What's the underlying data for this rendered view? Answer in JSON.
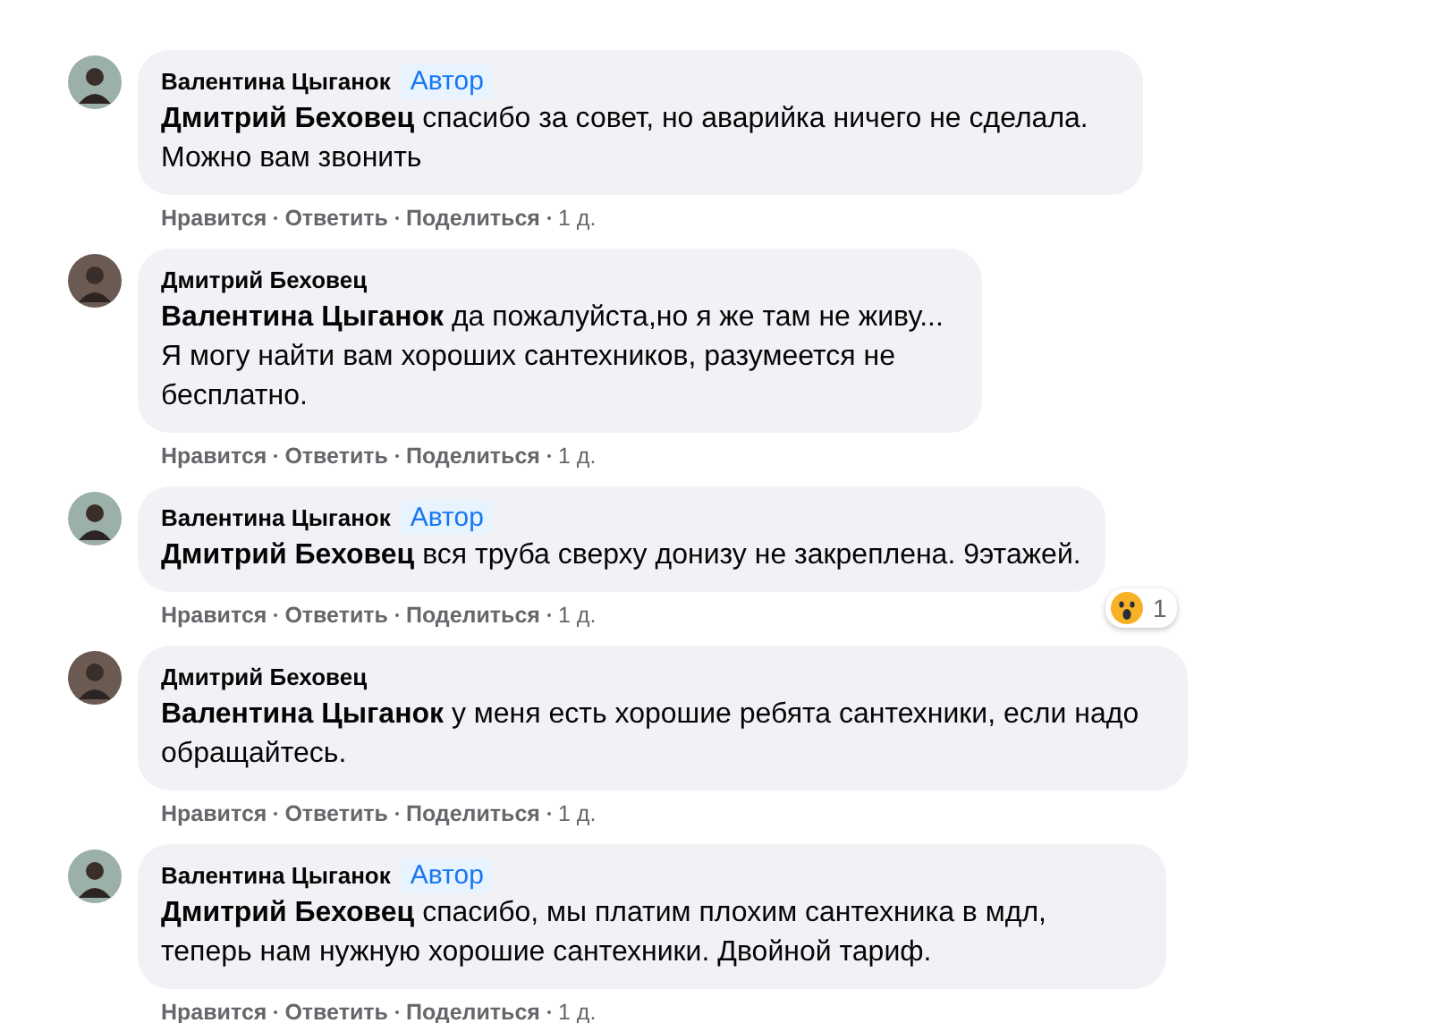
{
  "comments": [
    {
      "author": "Валентина Цыганок",
      "author_badge": "Автор",
      "mention": "Дмитрий Беховец",
      "text": "спасибо за совет, но аварийка ничего не сделала. Можно вам звонить",
      "actions": [
        "Нравится",
        "Ответить",
        "Поделиться"
      ],
      "time": "1 д."
    },
    {
      "author": "Дмитрий Беховец",
      "mention": "Валентина Цыганок",
      "text": "да пожалуйста,но я же там не живу... Я могу найти вам хороших сантехников, разумеется не бесплатно.",
      "actions": [
        "Нравится",
        "Ответить",
        "Поделиться"
      ],
      "time": "1 д."
    },
    {
      "author": "Валентина Цыганок",
      "author_badge": "Автор",
      "mention": "Дмитрий Беховец",
      "text": "вся труба сверху донизу не закреплена. 9этажей.",
      "actions": [
        "Нравится",
        "Ответить",
        "Поделиться"
      ],
      "time": "1 д.",
      "reaction": {
        "count": "1"
      }
    },
    {
      "author": "Дмитрий Беховец",
      "mention": "Валентина Цыганок",
      "text": "у меня есть хорошие ребята сантехники, если надо обращайтесь.",
      "actions": [
        "Нравится",
        "Ответить",
        "Поделиться"
      ],
      "time": "1 д."
    },
    {
      "author": "Валентина Цыганок",
      "author_badge": "Автор",
      "mention": "Дмитрий Беховец",
      "text": "спасибо, мы платим плохим сантехника в мдл, теперь нам нужную хорошие сантехники. Двойной тариф.",
      "actions": [
        "Нравится",
        "Ответить",
        "Поделиться"
      ],
      "time": "1 д."
    }
  ]
}
